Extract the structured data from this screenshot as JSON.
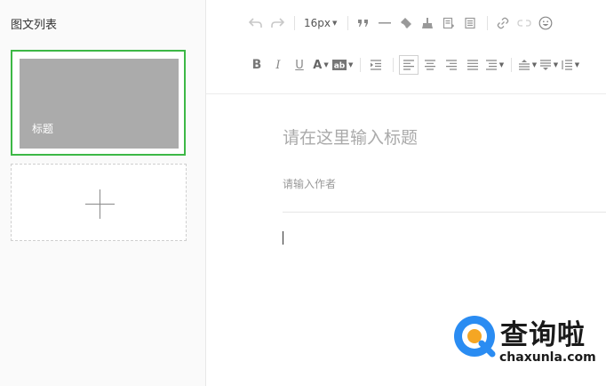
{
  "sidebar": {
    "title": "图文列表",
    "articles": [
      {
        "title": "标题"
      }
    ]
  },
  "toolbar": {
    "font_size": "16px",
    "row1_icons": [
      "undo-icon",
      "redo-icon",
      "font-size-select",
      "blockquote-icon",
      "horizontal-rule-icon",
      "eraser-icon",
      "format-brush-icon",
      "insert-template-icon",
      "paste-text-icon",
      "link-icon",
      "unlink-icon",
      "emoji-icon"
    ],
    "row2_icons": [
      "bold-icon",
      "italic-icon",
      "underline-icon",
      "font-color-icon",
      "background-color-icon",
      "indent-icon",
      "align-left-icon",
      "align-center-icon",
      "align-right-icon",
      "align-justify-icon",
      "list-spacing-icon",
      "paragraph-spacing-before-icon",
      "paragraph-spacing-after-icon",
      "line-height-icon"
    ]
  },
  "editor": {
    "title_placeholder": "请在这里输入标题",
    "author_placeholder": "请输入作者"
  },
  "watermark": {
    "cn": "查询啦",
    "en": "chaxunla.com"
  },
  "colors": {
    "selected_border": "#3db846",
    "thumb_bg": "#ababab",
    "watermark_blue": "#2a8cf2",
    "watermark_orange": "#f5a623"
  }
}
